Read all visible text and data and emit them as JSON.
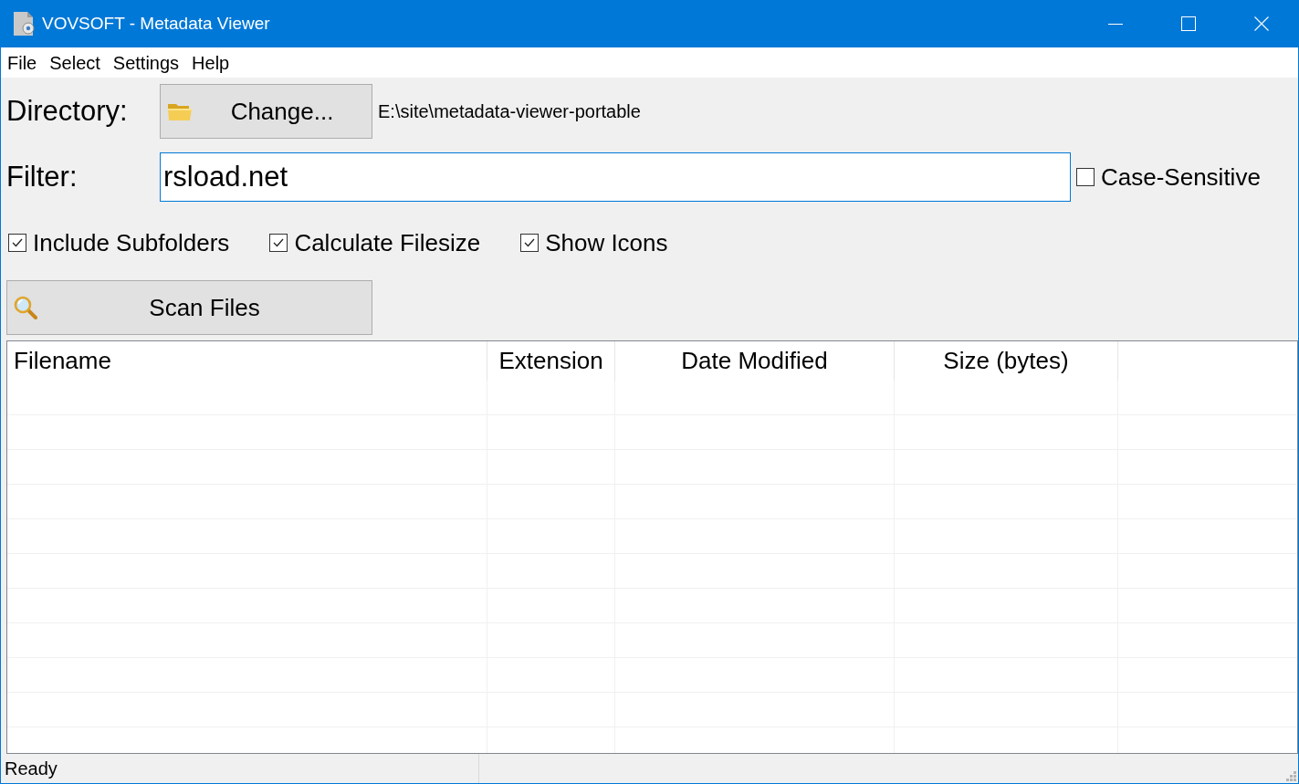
{
  "window": {
    "title": "VOVSOFT - Metadata Viewer"
  },
  "menu": [
    {
      "label": "File"
    },
    {
      "label": "Select"
    },
    {
      "label": "Settings"
    },
    {
      "label": "Help"
    }
  ],
  "directory": {
    "label": "Directory:",
    "button": "Change...",
    "path": "E:\\site\\metadata-viewer-portable"
  },
  "filter": {
    "label": "Filter:",
    "value": "rsload.net",
    "case_sensitive": {
      "label": "Case-Sensitive",
      "checked": false
    }
  },
  "options": [
    {
      "label": "Include Subfolders",
      "checked": true
    },
    {
      "label": "Calculate Filesize",
      "checked": true
    },
    {
      "label": "Show Icons",
      "checked": true
    }
  ],
  "scan_button": {
    "label": "Scan Files"
  },
  "table": {
    "columns": [
      "Filename",
      "Extension",
      "Date Modified",
      "Size (bytes)"
    ]
  },
  "status_bar": {
    "text": "Ready"
  }
}
